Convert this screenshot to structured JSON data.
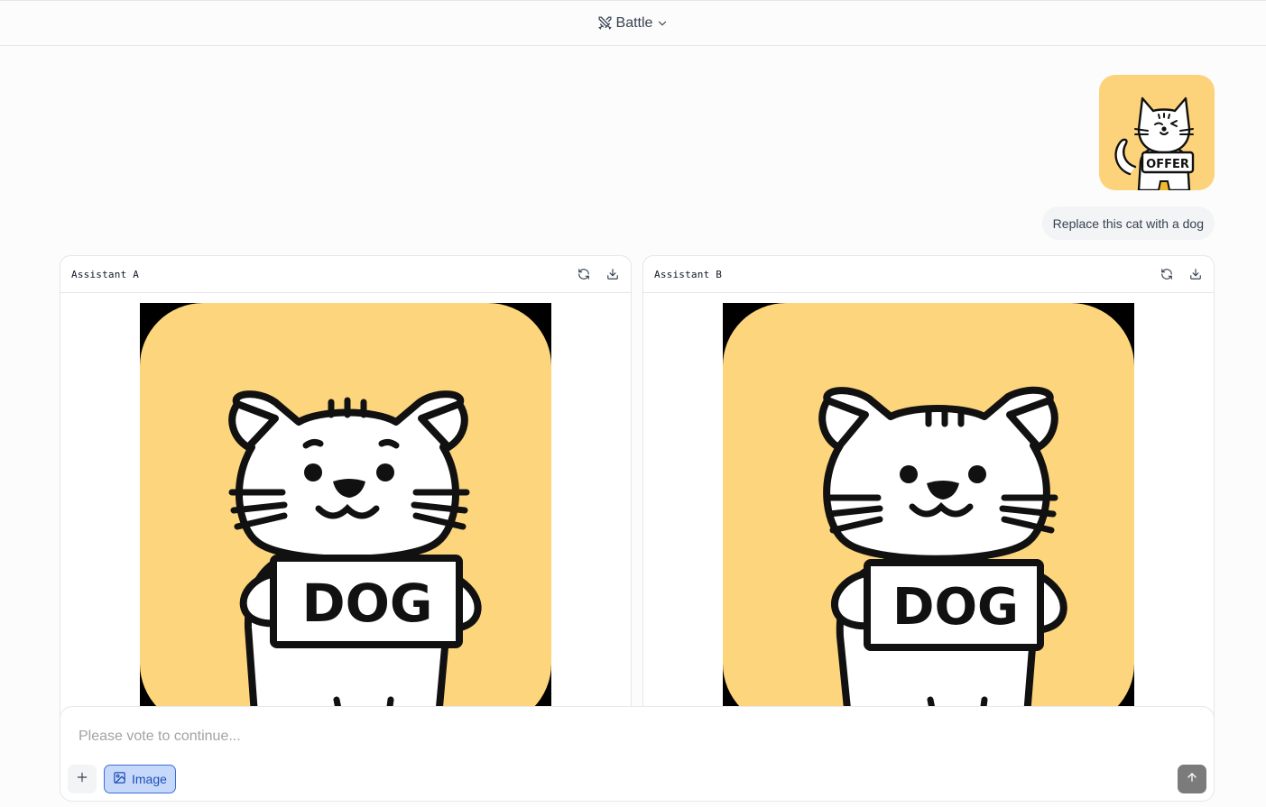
{
  "header": {
    "mode_label": "Battle",
    "mode_icon": "swords-icon",
    "dropdown_icon": "chevron-down-icon"
  },
  "user_message": {
    "image_sign_text": "OFFER",
    "image_background": "#fcd37a",
    "text": "Replace this cat with a dog"
  },
  "assistant_a": {
    "title": "Assistant A",
    "sign_text": "DOG",
    "actions": [
      "refresh-icon",
      "download-icon"
    ]
  },
  "assistant_b": {
    "title": "Assistant B",
    "sign_text": "DOG",
    "actions": [
      "refresh-icon",
      "download-icon"
    ]
  },
  "composer": {
    "placeholder": "Please vote to continue...",
    "image_toggle_label": "Image",
    "accent": "#3b6fd6"
  }
}
